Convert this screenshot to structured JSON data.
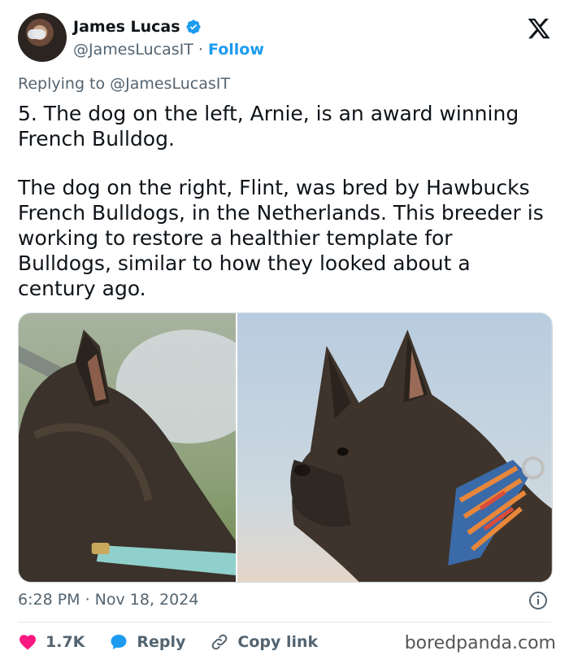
{
  "author": {
    "name": "James Lucas",
    "handle": "@JamesLucasIT",
    "separator": "·",
    "follow_label": "Follow"
  },
  "reply_to": "Replying to @JamesLucasIT",
  "tweet": {
    "paragraph1": "5. The dog on the left, Arnie, is an award winning French Bulldog.",
    "paragraph2": "The dog on the right, Flint, was bred by Hawbucks French Bulldogs, in the Netherlands. This breeder is working to restore a healthier template for Bulldogs, similar to how they looked about a century ago."
  },
  "media": {
    "left_image": "brindle-french-bulldog-arnie",
    "right_image": "brindle-french-bulldog-flint"
  },
  "meta": {
    "timestamp": "6:28 PM · Nov 18, 2024"
  },
  "actions": {
    "likes": "1.7K",
    "reply_label": "Reply",
    "copy_label": "Copy link"
  },
  "watermark": "boredpanda.com",
  "colors": {
    "accent": "#1d9bf0",
    "like": "#f91880",
    "text": "#0f1419",
    "muted": "#536471"
  },
  "icons": [
    "verified-badge-icon",
    "x-logo-icon",
    "info-icon",
    "heart-icon",
    "reply-bubble-icon",
    "link-icon"
  ]
}
